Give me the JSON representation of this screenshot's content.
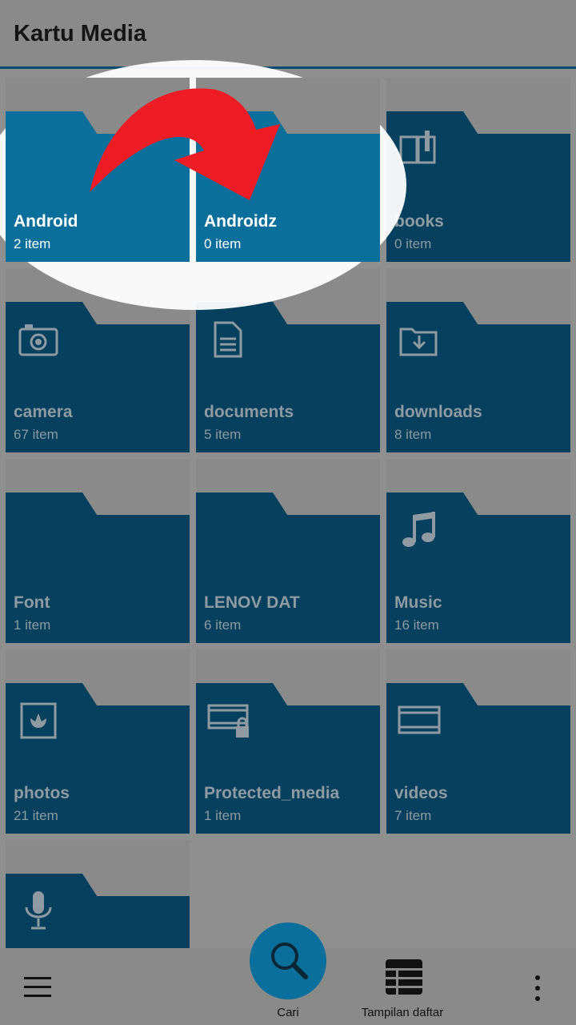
{
  "header": {
    "title": "Kartu Media"
  },
  "folders": [
    {
      "name": "Android",
      "count": "2 item",
      "icon": "none",
      "highlighted": true
    },
    {
      "name": "Androidz",
      "count": "0 item",
      "icon": "none",
      "highlighted": true
    },
    {
      "name": "books",
      "count": "0 item",
      "icon": "book-icon",
      "highlighted": false
    },
    {
      "name": "camera",
      "count": "67 item",
      "icon": "camera-icon",
      "highlighted": false
    },
    {
      "name": "documents",
      "count": "5 item",
      "icon": "document-icon",
      "highlighted": false
    },
    {
      "name": "downloads",
      "count": "8 item",
      "icon": "download-icon",
      "highlighted": false
    },
    {
      "name": "Font",
      "count": "1 item",
      "icon": "none",
      "highlighted": false
    },
    {
      "name": "LENOV DAT",
      "count": "6 item",
      "icon": "none",
      "highlighted": false
    },
    {
      "name": "Music",
      "count": "16 item",
      "icon": "music-note-icon",
      "highlighted": false
    },
    {
      "name": "photos",
      "count": "21 item",
      "icon": "photo-icon",
      "highlighted": false
    },
    {
      "name": "Protected_media",
      "count": "1 item",
      "icon": "locked-film-icon",
      "highlighted": false
    },
    {
      "name": "videos",
      "count": "7 item",
      "icon": "film-icon",
      "highlighted": false
    },
    {
      "name": "",
      "count": "",
      "icon": "microphone-icon",
      "highlighted": false
    }
  ],
  "bottom_bar": {
    "search_label": "Cari",
    "list_view_label": "Tampilan daftar"
  },
  "colors": {
    "folder_dim": "#05405e",
    "folder_highlight": "#0a6f9a",
    "arrow": "#ee1c24",
    "accent": "#0a6f9a"
  }
}
